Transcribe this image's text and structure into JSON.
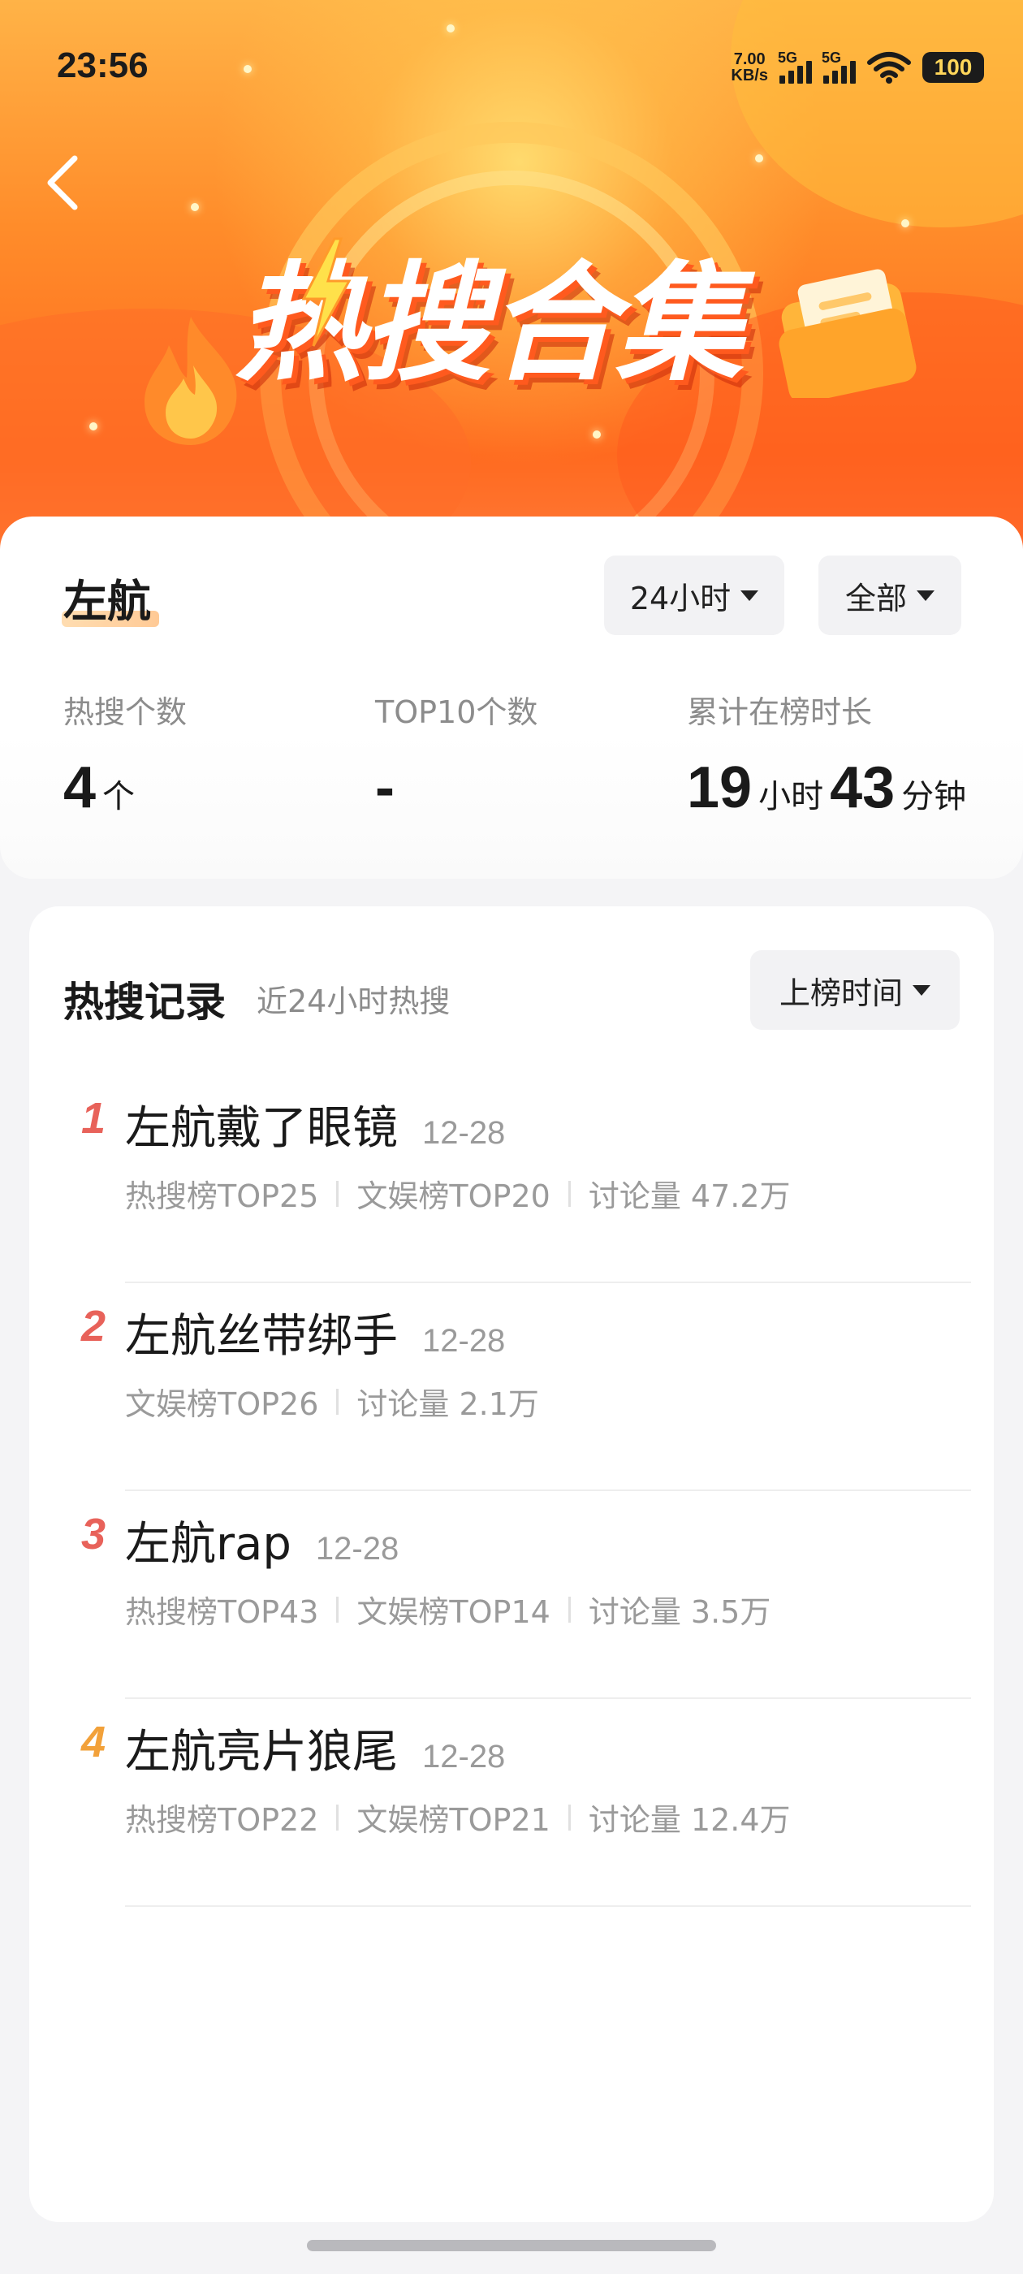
{
  "status_bar": {
    "time": "23:56",
    "net_speed_value": "7.00",
    "net_speed_unit": "KB/s",
    "sim1_label": "5G",
    "sim2_label": "5G",
    "battery": "100",
    "wifi_icon": "wifi-icon"
  },
  "hero": {
    "title": "热搜合集",
    "back_icon": "chevron-left-icon",
    "colors": {
      "primary": "#ff7a2a",
      "highlight": "#ffd65a"
    }
  },
  "summary": {
    "keyword": "左航",
    "time_filter": "24小时",
    "scope_filter": "全部",
    "stats": [
      {
        "label": "热搜个数",
        "value": "4",
        "unit": "个"
      },
      {
        "label": "TOP10个数",
        "value": "-"
      },
      {
        "label": "累计在榜时长",
        "hours": "19",
        "hours_unit": "小时",
        "minutes": "43",
        "minutes_unit": "分钟"
      }
    ]
  },
  "records": {
    "title": "热搜记录",
    "subtitle": "近24小时热搜",
    "sort_label": "上榜时间",
    "items": [
      {
        "rank": "1",
        "title": "左航戴了眼镜",
        "date": "12-28",
        "meta": [
          "热搜榜TOP25",
          "文娱榜TOP20",
          "讨论量 47.2万"
        ],
        "rank_color": "#e8625a"
      },
      {
        "rank": "2",
        "title": "左航丝带绑手",
        "date": "12-28",
        "meta": [
          "文娱榜TOP26",
          "讨论量 2.1万"
        ],
        "rank_color": "#e8625a"
      },
      {
        "rank": "3",
        "title": "左航rap",
        "date": "12-28",
        "meta": [
          "热搜榜TOP43",
          "文娱榜TOP14",
          "讨论量 3.5万"
        ],
        "rank_color": "#e8625a"
      },
      {
        "rank": "4",
        "title": "左航亮片狼尾",
        "date": "12-28",
        "meta": [
          "热搜榜TOP22",
          "文娱榜TOP21",
          "讨论量 12.4万"
        ],
        "rank_color": "#f2a13a"
      }
    ]
  }
}
